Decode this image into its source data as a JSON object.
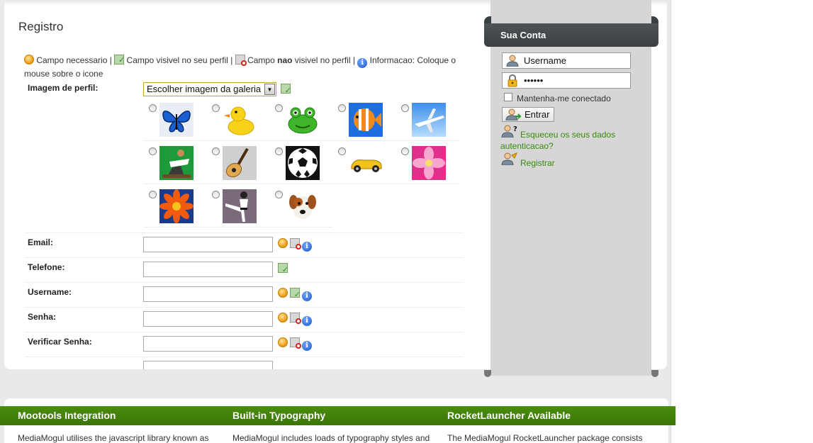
{
  "page": {
    "title": "Registro"
  },
  "legend": {
    "required": "Campo necessario |",
    "visible": "Campo visivel no seu perfil |",
    "not_visible_pre": "Campo",
    "not_visible_bold": "nao",
    "not_visible_post": "visivel no perfil |",
    "info": "Informacao: Coloque o mouse sobre o icone"
  },
  "form": {
    "profile_image_label": "Imagem de perfil:",
    "gallery_select_value": "Escolher imagem da galeria",
    "gallery": [
      "butterfly",
      "rubber-duck",
      "frog",
      "fish",
      "airplane",
      "skateboarder",
      "guitar",
      "soccer-ball",
      "race-car",
      "pink-flower",
      "orange-flower",
      "karate",
      "dog"
    ],
    "fields": [
      {
        "label": "Email:",
        "icons": [
          "required",
          "not-visible",
          "info"
        ]
      },
      {
        "label": "Telefone:",
        "icons": [
          "visible"
        ]
      },
      {
        "label": "Username:",
        "icons": [
          "required",
          "visible",
          "info"
        ]
      },
      {
        "label": "Senha:",
        "icons": [
          "required",
          "not-visible",
          "info"
        ]
      },
      {
        "label": "Verificar Senha:",
        "icons": [
          "required",
          "not-visible",
          "info"
        ]
      }
    ]
  },
  "sidebar": {
    "title": "Sua Conta",
    "username_value": "Username",
    "password_value": "••••••",
    "remember_label": "Mantenha-me conectado",
    "login_button": "Entrar",
    "forgot_link": "Esqueceu os seus dados autenticacao?",
    "register_link": "Registrar"
  },
  "features": [
    {
      "title": "Mootools Integration",
      "text": "MediaMogul utilises the javascript library known as"
    },
    {
      "title": "Built-in Typography",
      "text": "MediaMogul includes loads of typography styles and"
    },
    {
      "title": "RocketLauncher Available",
      "text": "The MediaMogul RocketLauncher package consists"
    }
  ]
}
